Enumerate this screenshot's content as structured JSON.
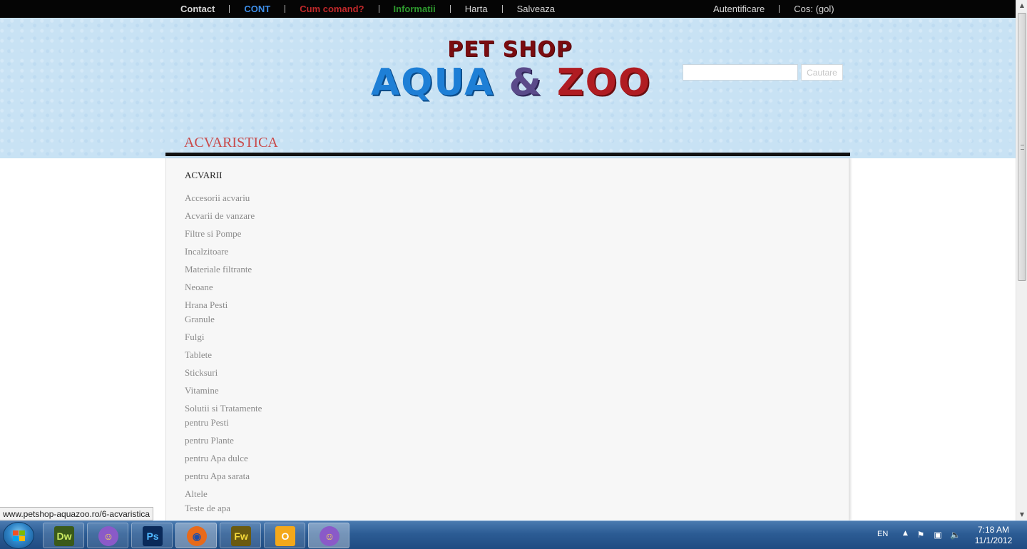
{
  "topnav": {
    "left": [
      {
        "label": "Contact",
        "color": "#d8d8d8",
        "bold": true
      },
      {
        "label": "CONT",
        "color": "#3d8ee8",
        "bold": true
      },
      {
        "label": "Cum comand?",
        "color": "#c0282a",
        "bold": true
      },
      {
        "label": "Informatii",
        "color": "#2e9a2e",
        "bold": true
      },
      {
        "label": "Harta",
        "color": "#d8d8d8",
        "bold": false
      },
      {
        "label": "Salveaza",
        "color": "#d8d8d8",
        "bold": false
      }
    ],
    "right": [
      {
        "label": "Autentificare"
      },
      {
        "label": "Cos: (gol)"
      }
    ]
  },
  "logo": {
    "line1": "PET SHOP",
    "aqua": "AQUA",
    "amp": "&",
    "zoo": "ZOO"
  },
  "search": {
    "value": "",
    "button_label": "Cautare"
  },
  "menu": {
    "active_tab": "ACVARISTICA"
  },
  "panel": {
    "heading": "ACVARII",
    "items": [
      {
        "label": "Accesorii acvariu",
        "tight": false
      },
      {
        "label": "Acvarii de vanzare",
        "tight": false
      },
      {
        "label": "Filtre si Pompe",
        "tight": false
      },
      {
        "label": "Incalzitoare",
        "tight": false
      },
      {
        "label": "Materiale filtrante",
        "tight": false
      },
      {
        "label": "Neoane",
        "tight": false
      },
      {
        "label": "Hrana Pesti",
        "tight": true
      },
      {
        "label": "Granule",
        "tight": false
      },
      {
        "label": "Fulgi",
        "tight": false
      },
      {
        "label": "Tablete",
        "tight": false
      },
      {
        "label": "Sticksuri",
        "tight": false
      },
      {
        "label": "Vitamine",
        "tight": false
      },
      {
        "label": "Solutii si Tratamente",
        "tight": true
      },
      {
        "label": "pentru Pesti",
        "tight": false
      },
      {
        "label": "pentru Plante",
        "tight": false
      },
      {
        "label": "pentru Apa dulce",
        "tight": false
      },
      {
        "label": "pentru Apa sarata",
        "tight": false
      },
      {
        "label": "Altele",
        "tight": true
      },
      {
        "label": "Teste de apa",
        "tight": false
      }
    ]
  },
  "status_url": "www.petshop-aquazoo.ro/6-acvaristica",
  "taskbar": {
    "apps": [
      {
        "name": "dreamweaver",
        "label": "Dw",
        "bg": "#3a5a1a",
        "fg": "#c8e860",
        "active": false
      },
      {
        "name": "yahoo-messenger-shield",
        "label": "☺",
        "bg": "#8a5ac8",
        "fg": "#ffe14a",
        "active": false
      },
      {
        "name": "photoshop",
        "label": "Ps",
        "bg": "#0a2a5a",
        "fg": "#4fb8ff",
        "active": false
      },
      {
        "name": "firefox",
        "label": "◉",
        "bg": "#e86a1a",
        "fg": "#1e4ea8",
        "active": true
      },
      {
        "name": "fireworks",
        "label": "Fw",
        "bg": "#6a5a10",
        "fg": "#f4d83a",
        "active": false
      },
      {
        "name": "outlook",
        "label": "O",
        "bg": "#f4a81a",
        "fg": "#ffffff",
        "active": false
      },
      {
        "name": "yahoo-messenger",
        "label": "☺",
        "bg": "#8a5ac8",
        "fg": "#ffe14a",
        "active": true
      }
    ],
    "language": "EN",
    "time": "7:18 AM",
    "date": "11/1/2012"
  }
}
